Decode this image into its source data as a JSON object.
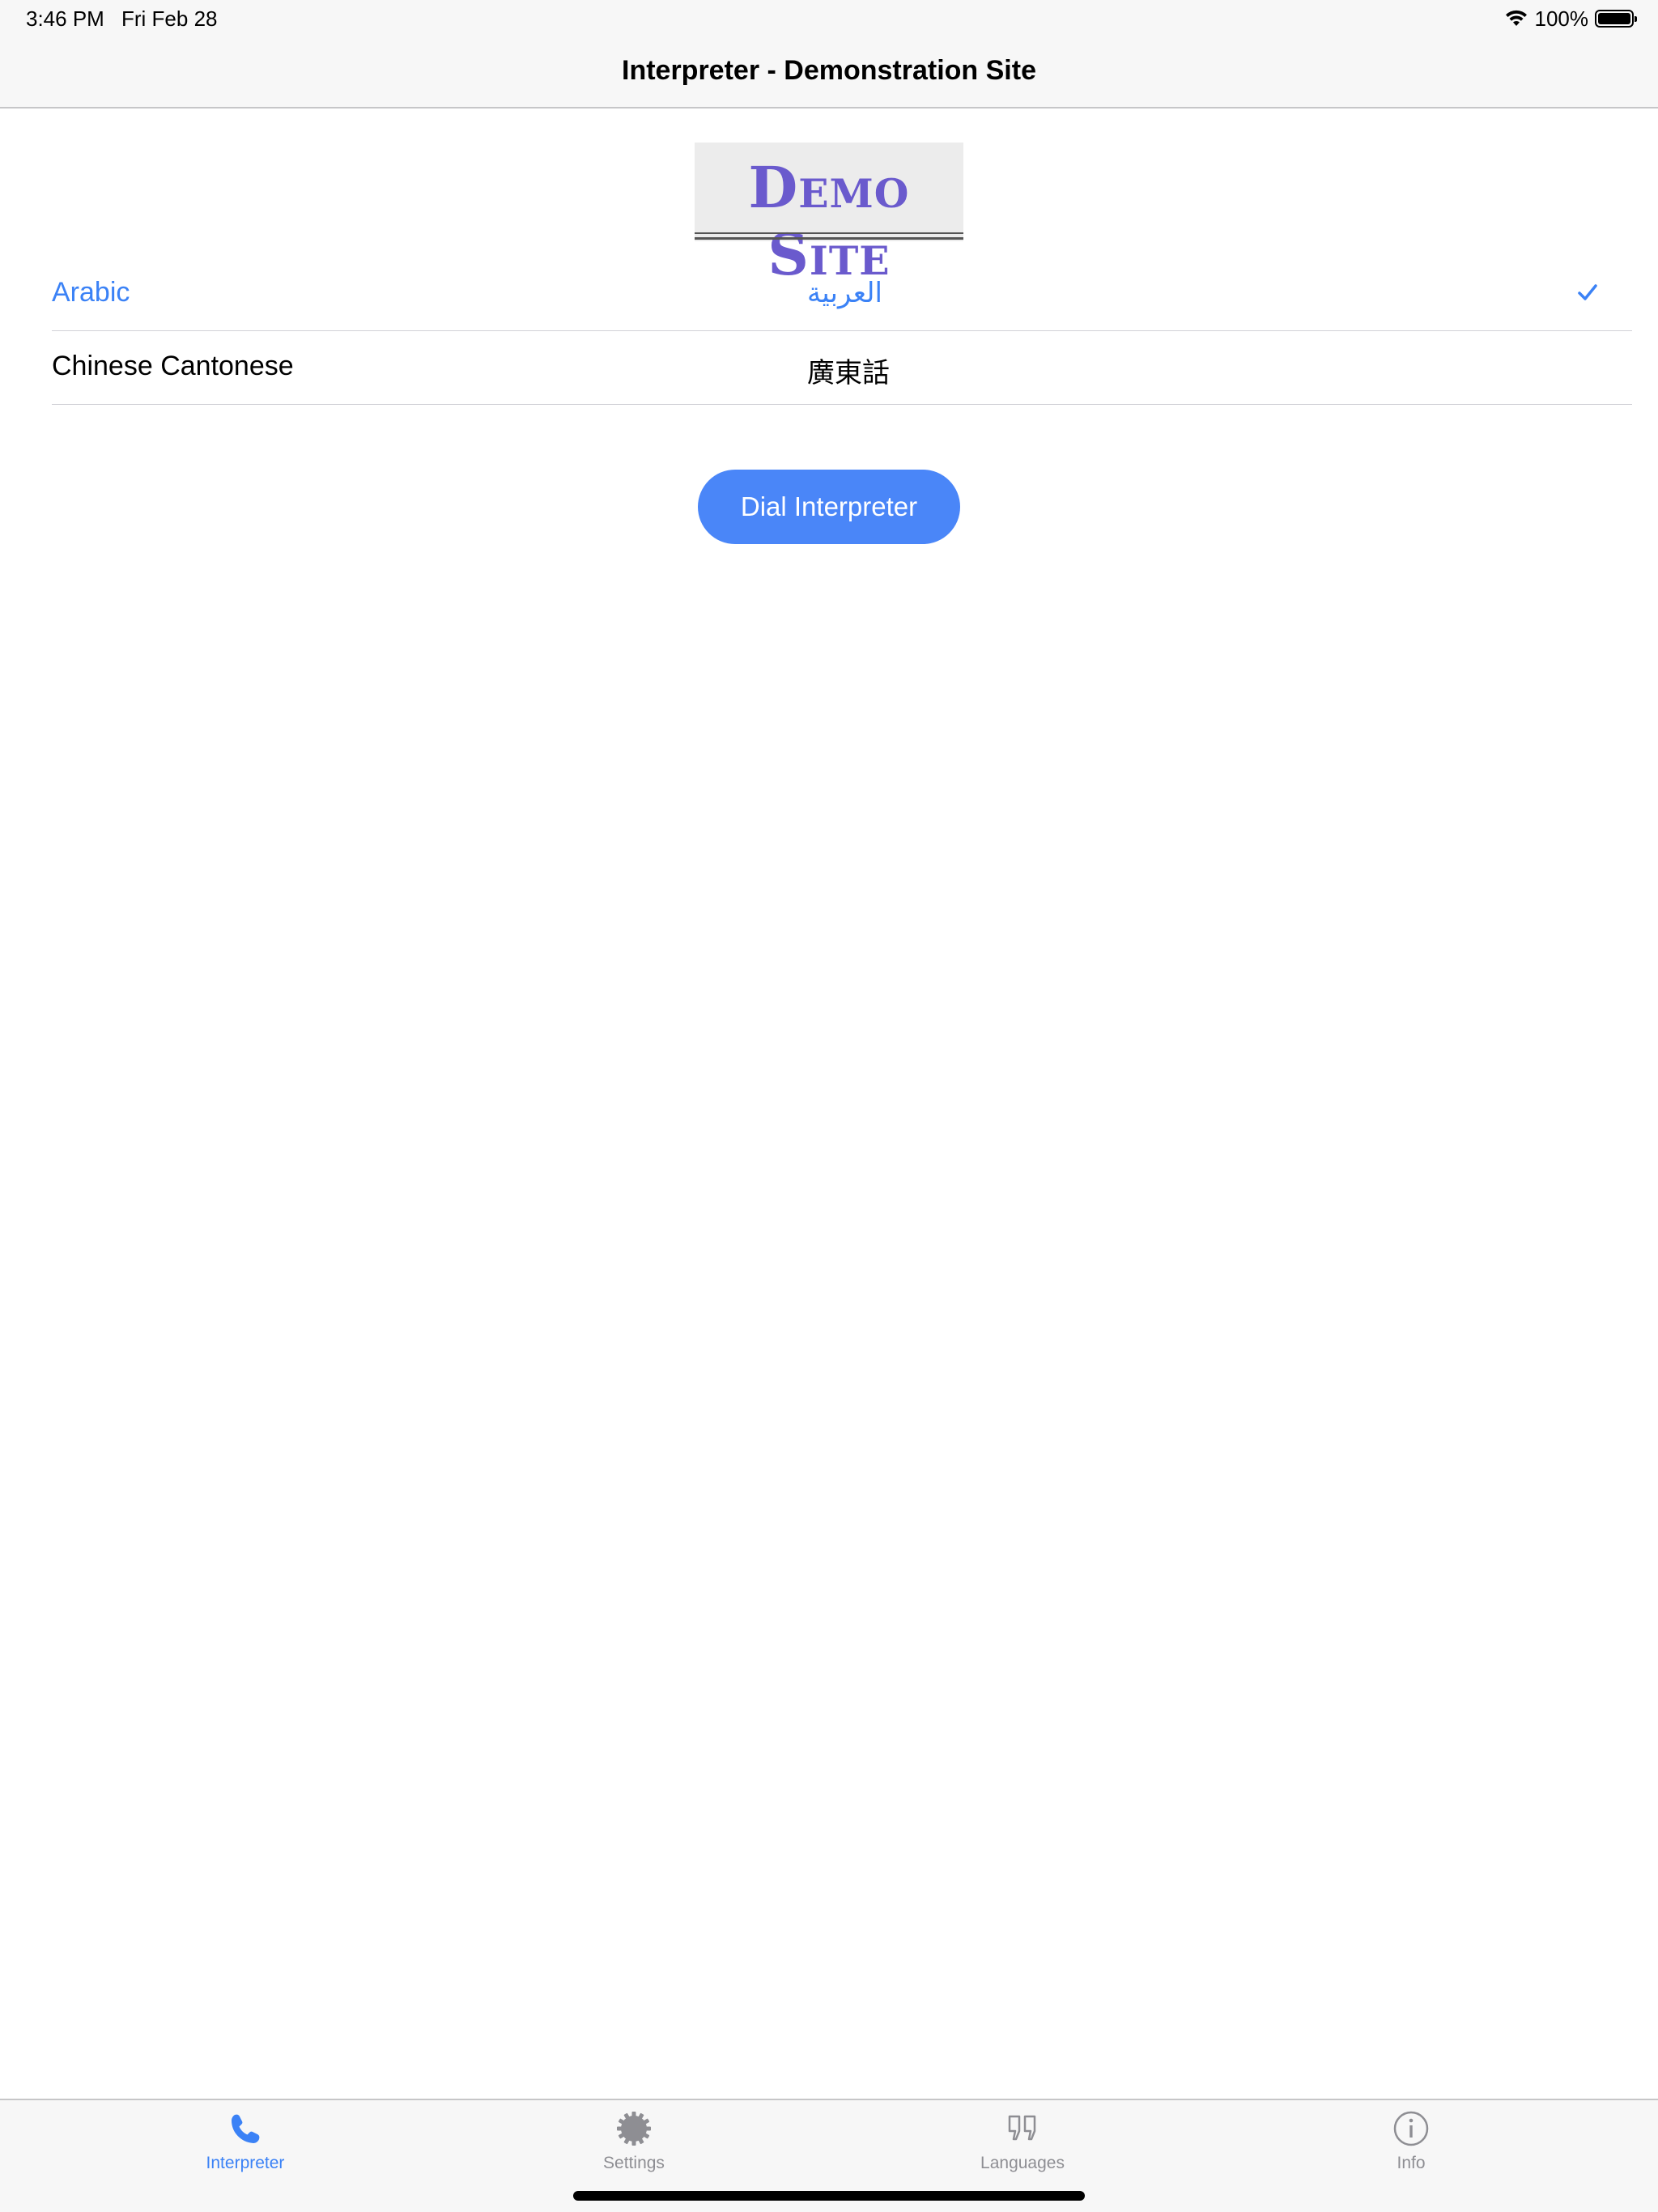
{
  "status_bar": {
    "time": "3:46 PM",
    "date": "Fri Feb 28",
    "battery": "100%"
  },
  "nav": {
    "title": "Interpreter - Demonstration Site"
  },
  "logo": {
    "text": "Demo Site",
    "color": "#6a5acd"
  },
  "languages": [
    {
      "name": "Arabic",
      "native": "العربية",
      "selected": true
    },
    {
      "name": "Chinese Cantonese",
      "native": "廣東話",
      "selected": false
    }
  ],
  "dial_button": {
    "label": "Dial Interpreter",
    "color": "#4a86f8"
  },
  "tabs": [
    {
      "label": "Interpreter",
      "icon": "phone-icon",
      "active": true
    },
    {
      "label": "Settings",
      "icon": "gear-icon",
      "active": false
    },
    {
      "label": "Languages",
      "icon": "quote-icon",
      "active": false
    },
    {
      "label": "Info",
      "icon": "info-icon",
      "active": false
    }
  ],
  "colors": {
    "accent": "#3b82f6",
    "inactive": "#8e8e93"
  }
}
